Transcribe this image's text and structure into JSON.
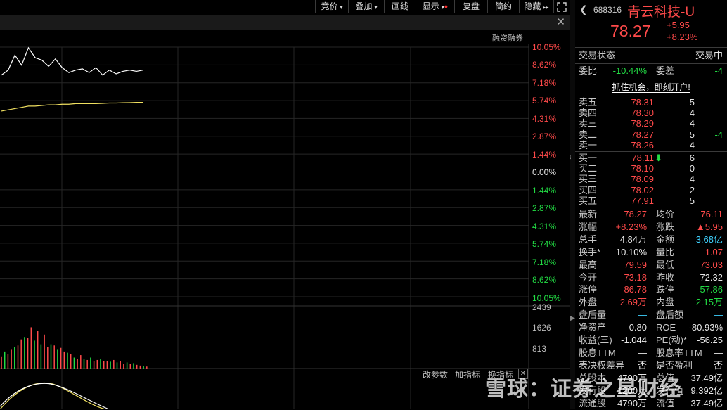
{
  "toolbar": {
    "items": [
      {
        "label": "竞价",
        "caret": "▾"
      },
      {
        "label": "叠加",
        "caret": "▾"
      },
      {
        "label": "画线"
      },
      {
        "label": "显示",
        "caret": "▾",
        "dot": "●"
      },
      {
        "label": "复盘"
      },
      {
        "label": "简约"
      },
      {
        "label": "隐藏",
        "caret": "▸▸"
      }
    ],
    "fullscreen_icon": "expand-icon",
    "back_icon": "chevron-left-icon"
  },
  "chart": {
    "close_label": "✕",
    "rongzi_label": "融资融券",
    "pct_labels_up": [
      "10.05%",
      "8.62%",
      "7.18%",
      "5.74%",
      "4.31%",
      "2.87%",
      "1.44%"
    ],
    "pct_zero": "0.00%",
    "pct_labels_down": [
      "1.44%",
      "2.87%",
      "4.31%",
      "5.74%",
      "7.18%",
      "8.62%",
      "10.05%"
    ],
    "volume_labels": [
      "2439",
      "1626",
      "813"
    ],
    "bottom_tools": [
      "改参数",
      "加指标",
      "换指标"
    ],
    "bottom_close": "✕",
    "colors": {
      "up": "#ff4a4a",
      "down": "#22dd44",
      "price_line": "#ffffff",
      "avg_line": "#f0e060"
    }
  },
  "chart_data": {
    "type": "line",
    "series": [
      {
        "values": [
          7.8,
          8.2,
          9.4,
          8.6,
          10.0,
          9.2,
          9.0,
          8.5,
          9.1,
          8.4,
          8.0,
          8.2,
          8.3,
          8.0,
          8.4,
          7.8,
          8.2,
          7.9,
          8.1,
          8.2,
          8.1,
          8.2
        ]
      },
      {
        "values": [
          4.9,
          5.0,
          5.1,
          5.2,
          5.3,
          5.3,
          5.35,
          5.4,
          5.4,
          5.45,
          5.45,
          5.5,
          5.5,
          5.5,
          5.5,
          5.52,
          5.55,
          5.55,
          5.57,
          5.58,
          5.6,
          5.6
        ]
      }
    ],
    "volume": [
      500,
      700,
      600,
      800,
      900,
      950,
      1200,
      1300,
      1250,
      1700,
      1150,
      1550,
      1000,
      1400,
      900,
      1000,
      950,
      800,
      850,
      700,
      650,
      600,
      450,
      400,
      550,
      400,
      350,
      450,
      300,
      350,
      400,
      300,
      320,
      280,
      350,
      250,
      300,
      200,
      250,
      180,
      220,
      150,
      120,
      100,
      80
    ],
    "volume_up": [
      true,
      false,
      true,
      true,
      false,
      true,
      true,
      false,
      true,
      true,
      false,
      true,
      false,
      true,
      true,
      false,
      true,
      false,
      true,
      true,
      false,
      true,
      false,
      true,
      true,
      false,
      true,
      false,
      true,
      true,
      false,
      true,
      true,
      false,
      true,
      false,
      true,
      true,
      false,
      true,
      false,
      true,
      true,
      false,
      true
    ],
    "ylim": [
      -10.05,
      10.05
    ],
    "volume_ylim": [
      0,
      2439
    ]
  },
  "quote": {
    "code": "688316",
    "name": "青云科技-U",
    "price": "78.27",
    "change": "+5.95",
    "change_pct": "+8.23%",
    "status_label": "交易状态",
    "status_value": "交易中",
    "weibi_label": "委比",
    "weibi_value": "-10.44%",
    "weicha_label": "委差",
    "weicha_value": "-4",
    "ad_text": "抓住机会，即刻开户!",
    "asks": [
      {
        "label": "卖五",
        "price": "78.31",
        "vol": "5",
        "extra": ""
      },
      {
        "label": "卖四",
        "price": "78.30",
        "vol": "4",
        "extra": ""
      },
      {
        "label": "卖三",
        "price": "78.29",
        "vol": "4",
        "extra": ""
      },
      {
        "label": "卖二",
        "price": "78.27",
        "vol": "5",
        "extra": "-4"
      },
      {
        "label": "卖一",
        "price": "78.26",
        "vol": "4",
        "extra": ""
      }
    ],
    "bids": [
      {
        "label": "买一",
        "price": "78.11",
        "vol": "6",
        "arrow": "⬇"
      },
      {
        "label": "买二",
        "price": "78.10",
        "vol": "0",
        "arrow": ""
      },
      {
        "label": "买三",
        "price": "78.09",
        "vol": "4",
        "arrow": ""
      },
      {
        "label": "买四",
        "price": "78.02",
        "vol": "2",
        "arrow": ""
      },
      {
        "label": "买五",
        "price": "77.91",
        "vol": "5",
        "arrow": ""
      }
    ],
    "stats": [
      {
        "l1": "最新",
        "v1": "78.27",
        "c1": "red",
        "l2": "均价",
        "v2": "76.11",
        "c2": "red"
      },
      {
        "l1": "涨幅",
        "v1": "+8.23%",
        "c1": "red",
        "l2": "涨跌",
        "v2": "▲5.95",
        "c2": "red"
      },
      {
        "l1": "总手",
        "v1": "4.84万",
        "c1": "white",
        "l2": "金额",
        "v2": "3.68亿",
        "c2": "cyan"
      },
      {
        "l1": "换手*",
        "v1": "10.10%",
        "c1": "white",
        "l2": "量比",
        "v2": "1.07",
        "c2": "red"
      },
      {
        "l1": "最高",
        "v1": "79.59",
        "c1": "red",
        "l2": "最低",
        "v2": "73.03",
        "c2": "red"
      },
      {
        "l1": "今开",
        "v1": "73.18",
        "c1": "red",
        "l2": "昨收",
        "v2": "72.32",
        "c2": "white"
      },
      {
        "l1": "涨停",
        "v1": "86.78",
        "c1": "red",
        "l2": "跌停",
        "v2": "57.86",
        "c2": "green"
      },
      {
        "l1": "外盘",
        "v1": "2.69万",
        "c1": "red",
        "l2": "内盘",
        "v2": "2.15万",
        "c2": "green"
      },
      {
        "l1": "盘后量",
        "v1": "—",
        "c1": "cyan",
        "l2": "盘后额",
        "v2": "—",
        "c2": "cyan"
      },
      {
        "l1": "净资产",
        "v1": "0.80",
        "c1": "white",
        "l2": "ROE",
        "v2": "-80.93%",
        "c2": "white"
      },
      {
        "l1": "收益(三)",
        "v1": "-1.044",
        "c1": "white",
        "l2": "PE(动)*",
        "v2": "-56.25",
        "c2": "white"
      },
      {
        "l1": "股息TTM",
        "v1": "—",
        "c1": "white",
        "l2": "股息率TTM",
        "v2": "—",
        "c2": "white"
      },
      {
        "l1": "表决权差异",
        "v1": "否",
        "c1": "white",
        "l2": "是否盈利",
        "v2": "否",
        "c2": "white"
      },
      {
        "l1": "总股本",
        "v1": "4790万",
        "c1": "white",
        "l2": "总值",
        "v2": "37.49亿",
        "c2": "white"
      },
      {
        "l1": "发行股",
        "v1": "1200万",
        "c1": "white",
        "l2": "发行值",
        "v2": "9.392亿",
        "c2": "white"
      },
      {
        "l1": "流通股",
        "v1": "4790万",
        "c1": "white",
        "l2": "流值",
        "v2": "37.49亿",
        "c2": "white"
      }
    ]
  },
  "watermark": "雪球：证券之星财经"
}
